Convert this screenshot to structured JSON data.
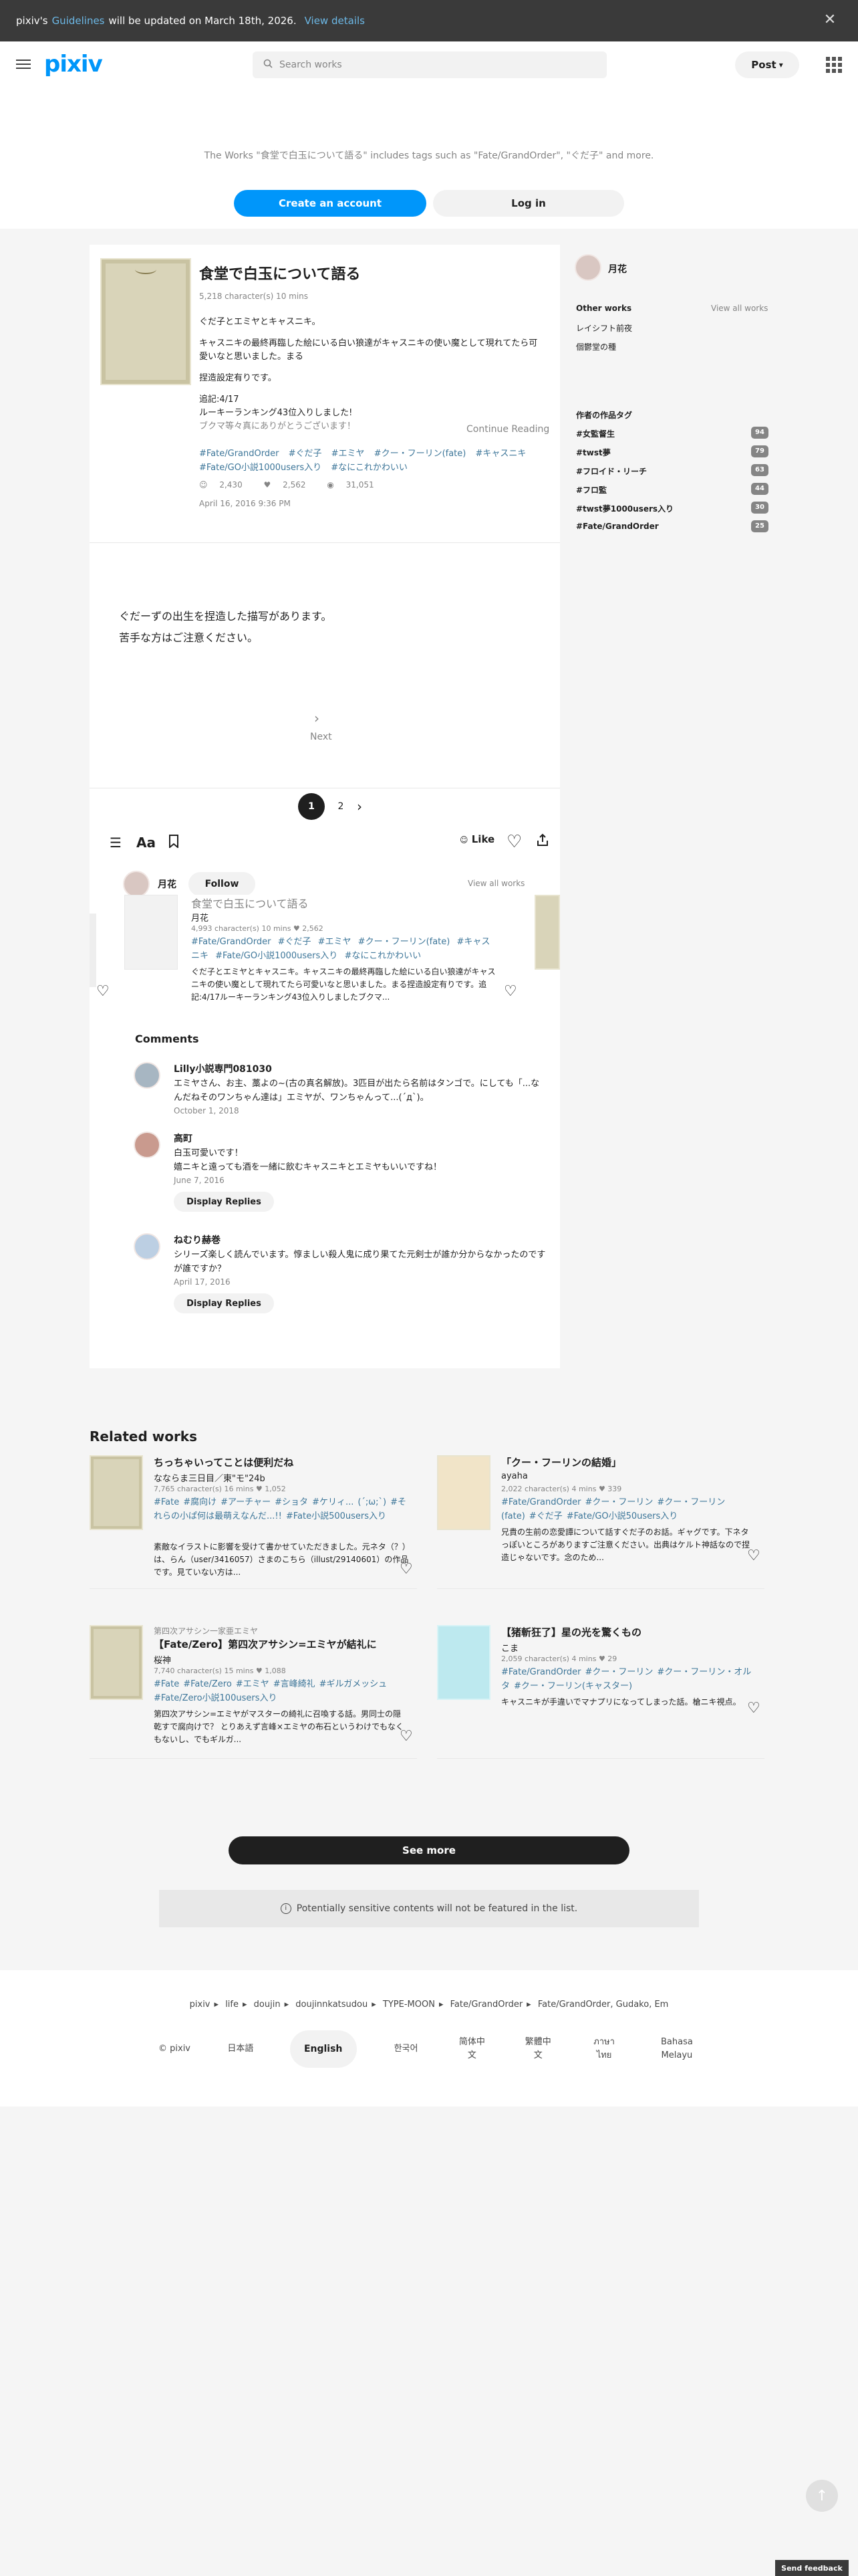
{
  "banner": {
    "prefix": "pixiv's",
    "link": "Guidelines",
    "suffix": "will be updated on March 18th, 2026.",
    "details": "View details",
    "close_icon": "close-icon"
  },
  "header": {
    "logo": "pixiv",
    "search_placeholder": "Search works",
    "post_label": "Post",
    "post_caret": "⌄"
  },
  "hero": {
    "message": "The Works \"食堂で白玉について語る\" includes tags such as \"Fate/GrandOrder\", \"ぐだ子\" and more.",
    "create_account": "Create an account",
    "login": "Log in"
  },
  "work": {
    "title": "食堂で白玉について語る",
    "meta": "5,218 character(s)  10 mins",
    "body": [
      "ぐだ子とエミヤとキャスニキ。",
      "キャスニキの最終再臨した絵にいる白い狼達がキャスニキの使い魔として現れてたら可愛いなと思いました。まる",
      "捏造設定有りです。",
      "追記:4/17",
      "ルーキーランキング43位入りしました!",
      "ブクマ等々真にありがとうございます！"
    ],
    "continue": "Continue Reading",
    "tags": [
      "#Fate/GrandOrder",
      "#ぐだ子",
      "#エミヤ",
      "#クー・フーリン(fate)",
      "#キャスニキ",
      "#Fate/GO小説1000users入り",
      "#なにこれかわいい"
    ],
    "stats": {
      "likes": "2,430",
      "bookmarks": "2,562",
      "views": "31,051"
    },
    "date": "April 16, 2016 9:36 PM",
    "text_lines": [
      "ぐだーずの出生を捏造した描写があります。",
      "苦手な方はご注意ください。"
    ],
    "next": "Next",
    "pages": [
      "1",
      "2"
    ],
    "like_label": "Like"
  },
  "author": {
    "name": "月花",
    "follow": "Follow",
    "view_all": "View all works"
  },
  "carousel": {
    "title": "食堂で白玉について語る",
    "author": "月花",
    "meta": "4,993 character(s)  10 mins  ♥ 2,562",
    "tags": [
      "#Fate/GrandOrder",
      "#ぐだ子",
      "#エミヤ",
      "#クー・フーリン(fate)",
      "#キャスニキ",
      "#Fate/GO小説1000users入り",
      "#なにこれかわいい"
    ],
    "desc": "ぐだ子とエミヤとキャスニキ。キャスニキの最終再臨した絵にいる白い狼達がキャスニキの使い魔として現れてたら可愛いなと思いました。まる捏造設定有りです。追記:4/17ルーキーランキング43位入りしましたブクマ..."
  },
  "comments": {
    "heading": "Comments",
    "items": [
      {
        "name": "Lilly小説専門081030",
        "text": "エミヤさん、お主、藁よの~(古の真名解放)。3匹目が出たら名前はタンゴで。にしても「...なんだねそのワンちゃん達は」エミヤが、ワンちゃんって...(´д`)。",
        "date": "October 1, 2018"
      },
      {
        "name": "高町",
        "text": "白玉可愛いです！\n嬉ニキと遠っても酒を一緒に飲むキャスニキとエミヤもいいですね！",
        "date": "June 7, 2016",
        "replies": "Display Replies"
      },
      {
        "name": "ねむり赫巻",
        "text": "シリーズ楽しく読んでいます。惇ましい殺人鬼に成り果てた元剣士が誰か分からなかったのですが誰ですか？",
        "date": "April 17, 2016",
        "replies": "Display Replies"
      }
    ]
  },
  "sidebar": {
    "author_name": "月花",
    "other_works": "Other works",
    "view_all": "View all works",
    "links": [
      "レイシフト前夜",
      "個鬱堂の種"
    ],
    "tags_heading": "作者の作品タグ",
    "tags": [
      {
        "name": "#女監督生",
        "count": "94"
      },
      {
        "name": "#twst夢",
        "count": "79"
      },
      {
        "name": "#フロイド・リーチ",
        "count": "63"
      },
      {
        "name": "#フロ監",
        "count": "44"
      },
      {
        "name": "#twst夢1000users入り",
        "count": "30"
      },
      {
        "name": "#Fate/GrandOrder",
        "count": "25"
      }
    ]
  },
  "related": {
    "heading": "Related works",
    "items": [
      {
        "series": "",
        "title": "ちっちゃいってことは便利だね",
        "author": "なならま三日目／東\"モ\"24b",
        "meta": "7,765 character(s)  16 mins  ♥ 1,052",
        "tags": [
          "#Fate",
          "#腐向け",
          "#アーチャー",
          "#ショタ",
          "#ケリィ...",
          "(´;ω;`)",
          "#それらの小ぱ何は最萌えなんだ...!!",
          "#Fate小説500users入り"
        ],
        "desc": "素敵なイラストに影響を受けて書かせていただきました。元ネタ（？）は、らん（user/3416057）さまのこちら（illust/29140601）の作品です。見ていない方は..."
      },
      {
        "series": "",
        "title": "「クー・フーリンの結婚」",
        "author": "ayaha",
        "meta": "2,022 character(s)  4 mins  ♥ 339",
        "tags": [
          "#Fate/GrandOrder",
          "#クー・フーリン",
          "#クー・フーリン(fate)",
          "#ぐだ子",
          "#Fate/GO小説50users入り"
        ],
        "desc": "兄貴の生前の恋愛譚について話すぐだ子のお話。ギャグです。下ネタっぽいところがありますご注意ください。出典はケルト神話なので捏造じゃないです。念のため..."
      },
      {
        "series": "第四次アサシン一家亜エミヤ",
        "title": "【Fate/Zero】第四次アサシン=エミヤが結礼に",
        "author": "桜神",
        "meta": "7,740 character(s)  15 mins  ♥ 1,088",
        "tags": [
          "#Fate",
          "#Fate/Zero",
          "#エミヤ",
          "#言峰綺礼",
          "#ギルガメッシュ",
          "#Fate/Zero小説100users入り"
        ],
        "desc": "第四次アサシン=エミヤがマスターの綺礼に召喚する話。男同士の隠乾すで腐向けで？ とりあえず言峰×エミヤの布石というわけでもなくもないし、でもギルガ..."
      },
      {
        "series": "",
        "title": "【猪斬狂了】星の光を驚くもの",
        "author": "こま",
        "meta": "2,059 character(s)  4 mins  ♥ 29",
        "tags": [
          "#Fate/GrandOrder",
          "#クー・フーリン",
          "#クー・フーリン・オルタ",
          "#クー・フーリン(キャスター)"
        ],
        "desc": "キャスニキが手違いでマナプリになってしまった話。槍ニキ視点。"
      }
    ],
    "see_more": "See more",
    "sensitive": "Potentially sensitive contents will not be featured in the list."
  },
  "footer": {
    "breadcrumb": [
      "pixiv",
      "life",
      "doujin",
      "doujinnkatsudou",
      "TYPE-MOON",
      "Fate/GrandOrder",
      "Fate/GrandOrder, Gudako, Em"
    ],
    "langs": [
      "© pixiv",
      "日本語",
      "English",
      "한국어",
      "简体中文",
      "繁體中文",
      "ภาษาไทย",
      "Bahasa Melayu"
    ],
    "feedback": "Send feedback"
  },
  "colors": {
    "accent": "#0096fa",
    "tag": "#3d7699",
    "banner_bg": "#3a3a3a"
  }
}
